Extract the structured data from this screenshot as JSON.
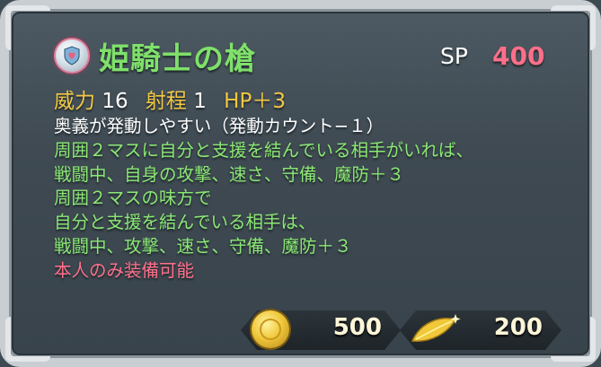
{
  "skill": {
    "name": "姫騎士の槍",
    "icon": "pink-heart-shield-icon",
    "sp_label": "SP",
    "sp_value": "400"
  },
  "stats": {
    "might_label": "威力",
    "might_value": "16",
    "range_label": "射程",
    "range_value": "1",
    "hp_bonus": "HP＋3"
  },
  "description": [
    {
      "text": "奥義が発動しやすい（発動カウント−１）",
      "color": "white"
    },
    {
      "text": "周囲２マスに自分と支援を結んでいる相手がいれば、",
      "color": "green"
    },
    {
      "text": "戦闘中、自身の攻撃、速さ、守備、魔防＋３",
      "color": "green"
    },
    {
      "text": "周囲２マスの味方で",
      "color": "green"
    },
    {
      "text": "自分と支援を結んでいる相手は、",
      "color": "green"
    },
    {
      "text": "戦闘中、攻撃、速さ、守備、魔防＋３",
      "color": "green"
    },
    {
      "text": "本人のみ装備可能",
      "color": "pink"
    }
  ],
  "costs": {
    "gold_icon": "gold-coin-icon",
    "gold_value": "500",
    "dew_icon": "sparkling-leaf-icon",
    "dew_value": "200"
  },
  "colors": {
    "title": "#7fe06a",
    "effect_text": "#8be874",
    "exclusive_text": "#ff6f8a",
    "stat_label": "#f2c744",
    "sp_value": "#ff6f8a"
  }
}
